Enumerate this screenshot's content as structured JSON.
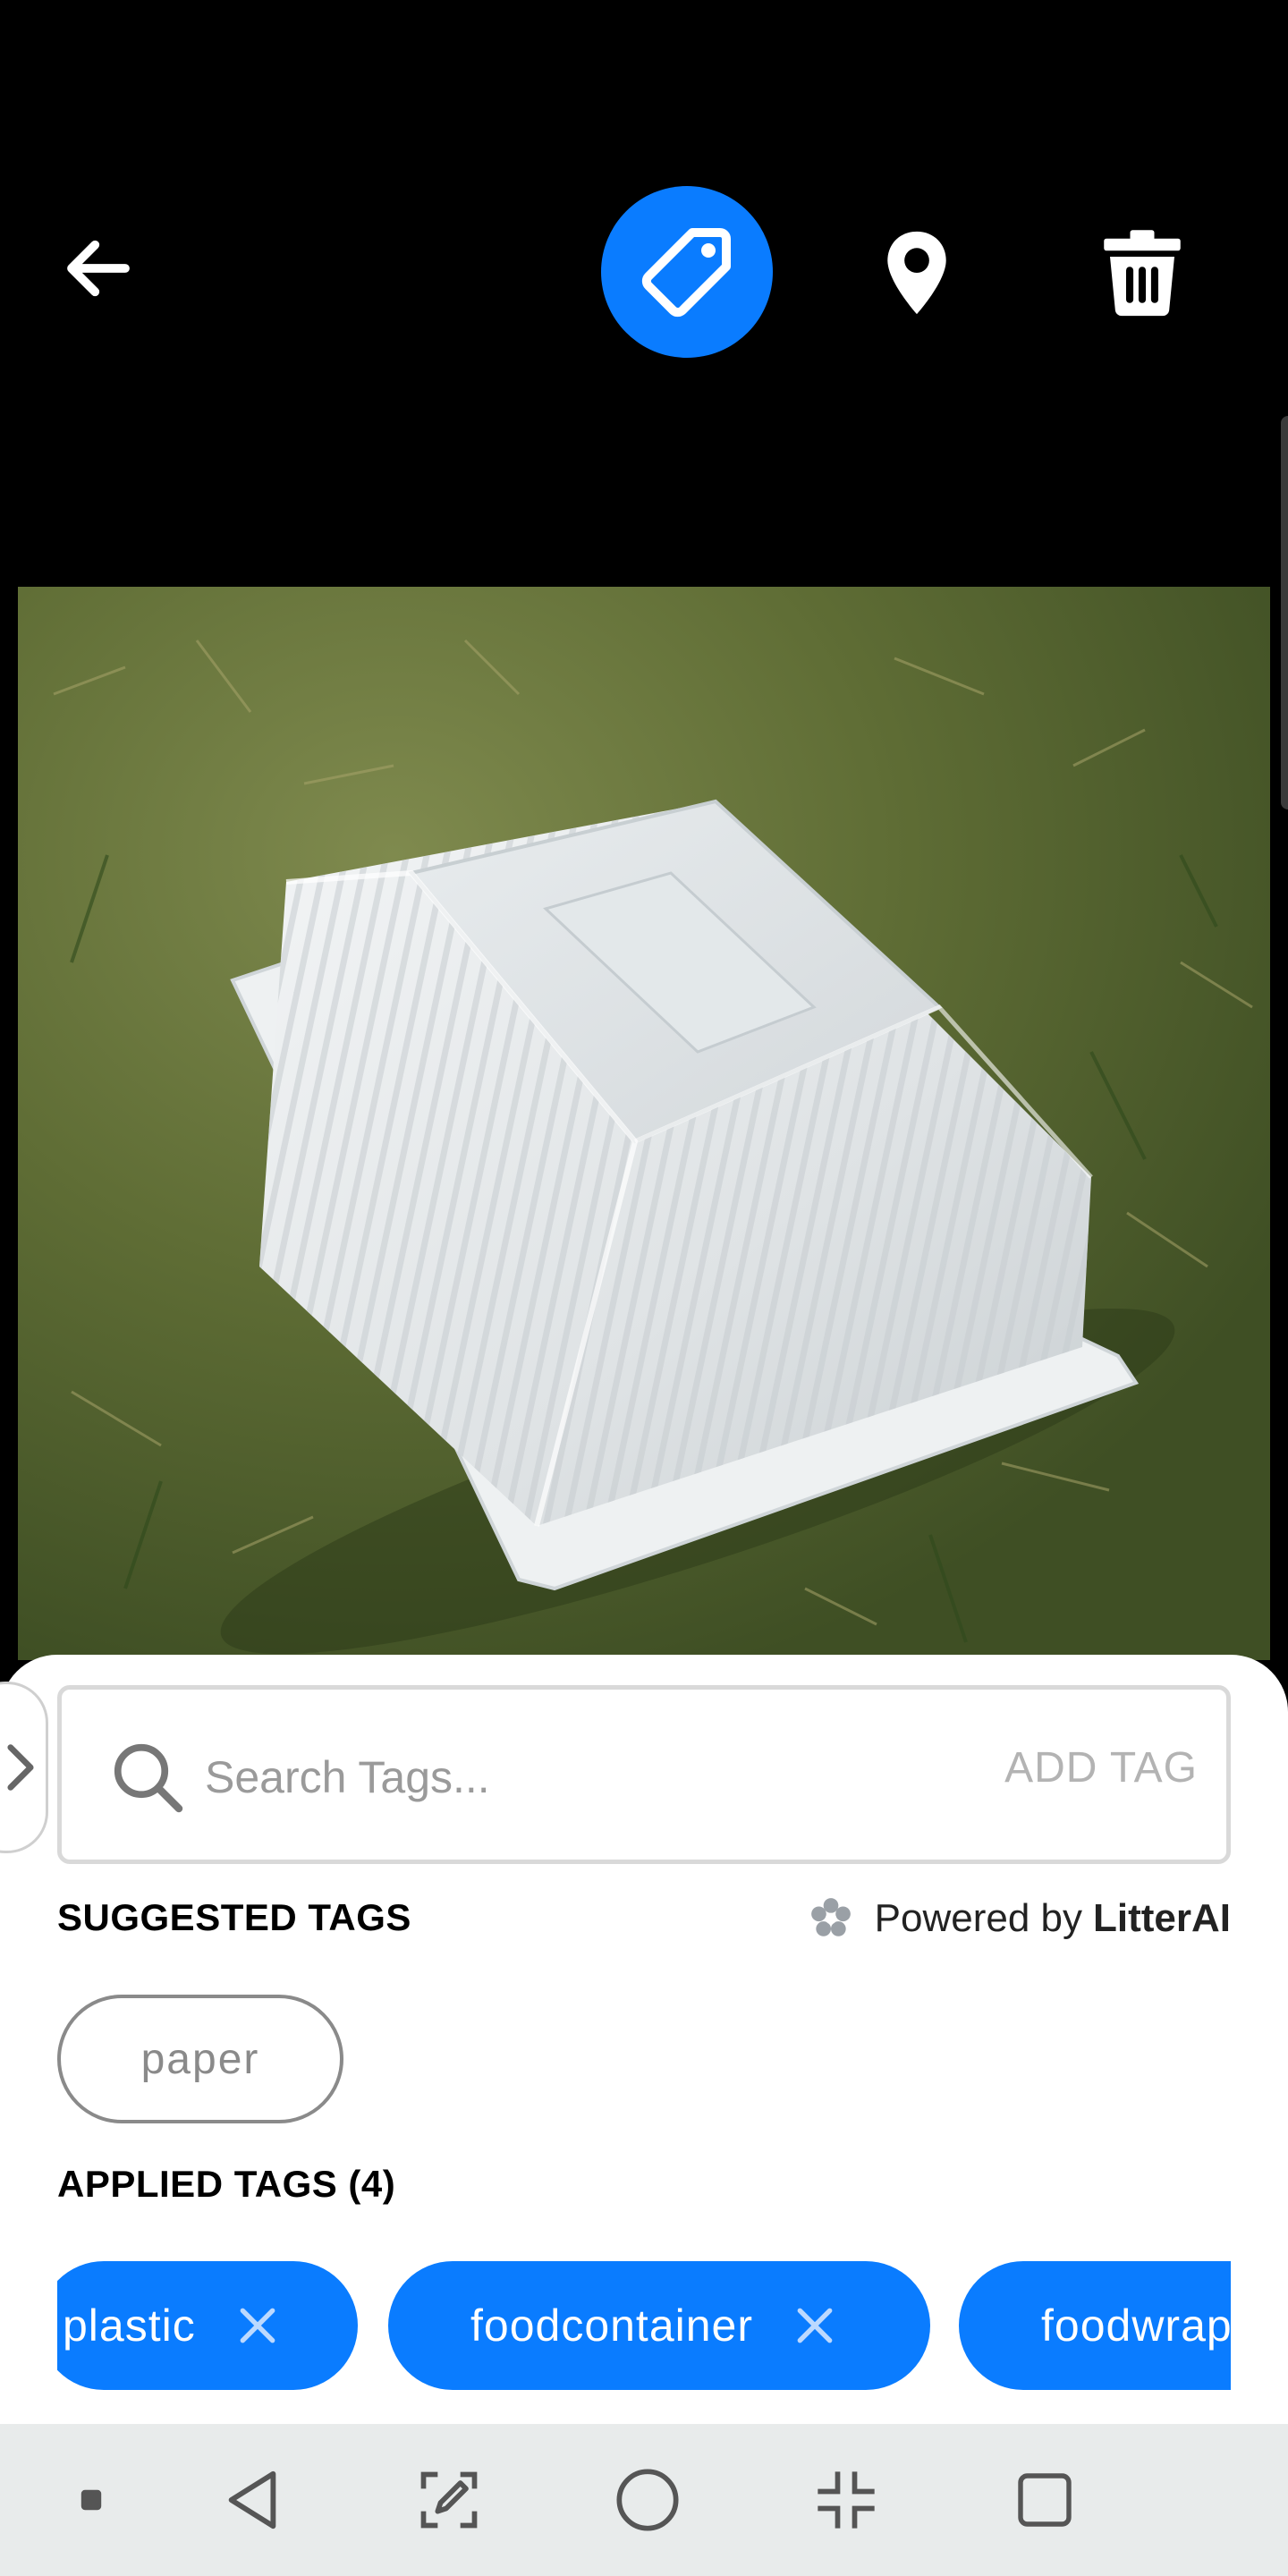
{
  "toolbar": {
    "back_icon": "arrow-left-icon",
    "tag_icon": "tag-icon",
    "location_icon": "map-pin-icon",
    "delete_icon": "trash-icon",
    "accent_color": "#0a7cff"
  },
  "photo": {
    "subject": "white plastic food container on grass"
  },
  "search": {
    "placeholder": "Search Tags...",
    "value": "",
    "add_tag_label": "ADD TAG"
  },
  "suggested": {
    "title": "SUGGESTED TAGS",
    "powered_prefix": "Powered by",
    "powered_brand": "LitterAI",
    "tags": [
      "paper"
    ]
  },
  "applied": {
    "title": "APPLIED TAGS (4)",
    "tags": [
      "plastic",
      "foodcontainer",
      "foodwrap"
    ]
  },
  "navbar": {
    "items": [
      "dot-icon",
      "back-triangle-icon",
      "edit-screenshot-icon",
      "home-circle-icon",
      "collapse-icon",
      "recents-square-icon"
    ]
  }
}
